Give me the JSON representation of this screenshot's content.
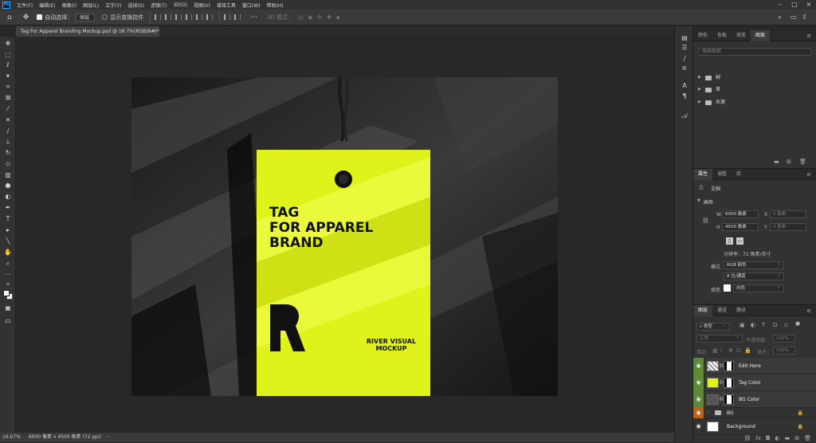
{
  "app": {
    "logo": "Ps"
  },
  "menu": [
    "文件(F)",
    "编辑(E)",
    "图像(I)",
    "图层(L)",
    "文字(Y)",
    "选择(S)",
    "滤镜(T)",
    "3D(D)",
    "视图(V)",
    "增效工具",
    "窗口(W)",
    "帮助(H)"
  ],
  "options": {
    "auto_select_label": "自动选择：",
    "auto_select_value": "图层",
    "show_transform_label": "显示变换控件",
    "mode_3d_label": "3D 模式：",
    "more": "···"
  },
  "document": {
    "tab_title": "Tag For Apparel Branding Mockup.psd @ 16.7%(RGB/8#)",
    "tab_modified": "*",
    "close": "×"
  },
  "tag": {
    "headline": [
      "TAG",
      "FOR APPAREL",
      "BRAND"
    ],
    "footer": [
      "RIVER VISUAL",
      "MOCKUP"
    ],
    "color": "#dff219"
  },
  "status": {
    "zoom": "16.67%",
    "size": "6000 像素 x 4500 像素 (72 ppi)"
  },
  "libraries_panel": {
    "tabs": [
      "颜色",
      "色板",
      "渐变",
      "图案"
    ],
    "active_tab": "图案",
    "search_placeholder": "搜索图案",
    "folders": [
      "树",
      "草",
      "水滴"
    ]
  },
  "properties_panel": {
    "tabs": [
      "属性",
      "调整",
      "库"
    ],
    "doc_label": "文档",
    "canvas_section": "画布",
    "w_label": "W",
    "w_value": "6000 像素",
    "x_label": "X",
    "x_value": "0 像素",
    "h_label": "H",
    "h_value": "4500 像素",
    "y_label": "Y",
    "y_value": "0 像素",
    "resolution": "分辨率：72 像素/英寸",
    "mode_label": "模式",
    "mode_value": "RGB 颜色",
    "depth_value": "8 位/通道",
    "fill_label": "填色",
    "fill_value": "白色"
  },
  "layers_panel": {
    "tabs": [
      "图层",
      "通道",
      "路径"
    ],
    "filter_kind": "类型",
    "blend_mode": "正常",
    "opacity_label": "不透明度：",
    "opacity_value": "100%",
    "lock_label": "锁定：",
    "fill_label": "填充：",
    "fill_value": "100%",
    "layers": [
      {
        "name": "Edit Here",
        "eye_color": "#5f8a3a"
      },
      {
        "name": "Tag Color",
        "eye_color": "#5f8a3a"
      },
      {
        "name": "BG Color",
        "eye_color": "#5f8a3a"
      },
      {
        "name": "BG",
        "eye_color": "#b5651d"
      },
      {
        "name": "Background",
        "eye_color": "#323232"
      }
    ]
  }
}
